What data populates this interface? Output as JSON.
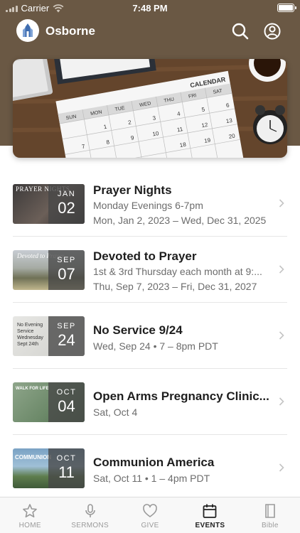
{
  "status_bar": {
    "carrier": "Carrier",
    "time": "7:48 PM"
  },
  "header": {
    "title": "Osborne"
  },
  "hero": {
    "calendar_heading": "CALENDAR",
    "weekdays": [
      "SUN",
      "MON",
      "TUE",
      "WED",
      "THU",
      "FRI",
      "SAT"
    ]
  },
  "events": [
    {
      "title": "Prayer Nights",
      "line1": "Monday Evenings 6-7pm",
      "line2": "Mon, Jan 2, 2023 – Wed, Dec 31, 2025",
      "month": "JAN",
      "day": "02",
      "thumb_text": "PRAYER NIGHTS"
    },
    {
      "title": "Devoted to Prayer",
      "line1": "1st & 3rd Thursday each month at 9:...",
      "line2": "Thu, Sep 7, 2023 – Fri, Dec 31, 2027",
      "month": "SEP",
      "day": "07",
      "thumb_text": "Devoted to Prayer"
    },
    {
      "title": "No Service 9/24",
      "line1": "Wed, Sep 24 • 7 – 8pm PDT",
      "line2": "",
      "month": "SEP",
      "day": "24",
      "thumb_text": "No Evening Service Wednesday Sept 24th"
    },
    {
      "title": "Open Arms Pregnancy Clinic...",
      "line1": "Sat, Oct 4",
      "line2": "",
      "month": "OCT",
      "day": "04",
      "thumb_text": "WALK FOR LIFE"
    },
    {
      "title": "Communion America",
      "line1": "Sat, Oct 11 • 1 – 4pm PDT",
      "line2": "",
      "month": "OCT",
      "day": "11",
      "thumb_text": "COMMUNION"
    }
  ],
  "tabs": [
    {
      "label": "HOME",
      "icon": "star-icon"
    },
    {
      "label": "SERMONS",
      "icon": "microphone-icon"
    },
    {
      "label": "GIVE",
      "icon": "heart-icon"
    },
    {
      "label": "EVENTS",
      "icon": "calendar-icon",
      "active": true
    },
    {
      "label": "Bible",
      "icon": "book-icon"
    }
  ],
  "colors": {
    "header_brown": "#6a5844",
    "active_tab": "#222222",
    "inactive_tab": "#9a9a9a"
  }
}
